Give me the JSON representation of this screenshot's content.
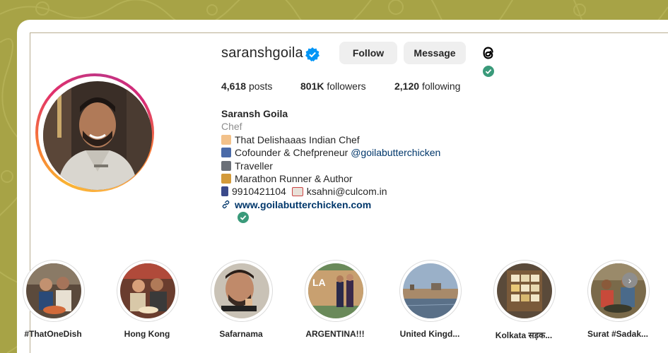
{
  "profile": {
    "username": "saranshgoila",
    "follow_label": "Follow",
    "message_label": "Message"
  },
  "stats": {
    "posts_count": "4,618",
    "posts_label": "posts",
    "followers_count": "801K",
    "followers_label": "followers",
    "following_count": "2,120",
    "following_label": "following"
  },
  "bio": {
    "name": "Saransh Goila",
    "category": "Chef",
    "line1": "That Delishaaas Indian Chef",
    "line2_text": "Cofounder & Chefpreneur",
    "line2_mention": "@goilabutterchicken",
    "line3": "Traveller",
    "line4": "Marathon Runner & Author",
    "line5_phone": "9910421104",
    "line5_email": "ksahni@culcom.in",
    "website": "www.goilabutterchicken.com"
  },
  "highlights": [
    {
      "label": "#ThatOneDish"
    },
    {
      "label": "Hong Kong"
    },
    {
      "label": "Safarnama"
    },
    {
      "label": "ARGENTINA!!!"
    },
    {
      "label": "United Kingd..."
    },
    {
      "label": "Kolkata सड़क..."
    },
    {
      "label": "Surat #Sadak..."
    }
  ],
  "colors": {
    "background": "#a7a346",
    "link": "#00376b",
    "verified": "#0095f6",
    "check": "#3a9a7a"
  }
}
